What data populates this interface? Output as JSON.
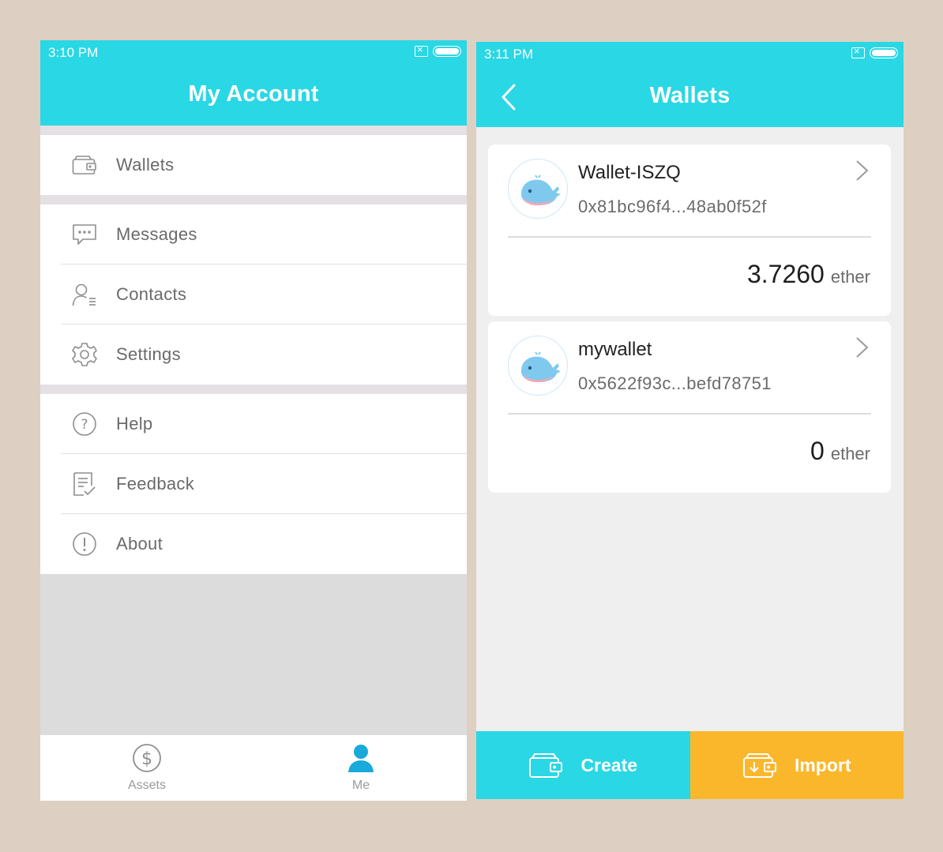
{
  "colors": {
    "accent": "#2ad7e4",
    "import": "#fbb72c",
    "active_tab": "#1aa9db",
    "inactive_tab": "#9a9a9a"
  },
  "left": {
    "status_time": "3:10 PM",
    "title": "My Account",
    "menu": {
      "wallets": {
        "label": "Wallets",
        "icon": "wallet-icon"
      },
      "messages": {
        "label": "Messages",
        "icon": "message-bubble-icon"
      },
      "contacts": {
        "label": "Contacts",
        "icon": "contacts-icon"
      },
      "settings": {
        "label": "Settings",
        "icon": "gear-icon"
      },
      "help": {
        "label": "Help",
        "icon": "question-circle-icon"
      },
      "feedback": {
        "label": "Feedback",
        "icon": "feedback-doc-icon"
      },
      "about": {
        "label": "About",
        "icon": "exclamation-circle-icon"
      }
    },
    "tabs": {
      "assets": {
        "label": "Assets",
        "icon": "dollar-circle-icon",
        "active": false
      },
      "me": {
        "label": "Me",
        "icon": "person-icon",
        "active": true
      }
    }
  },
  "right": {
    "status_time": "3:11 PM",
    "title": "Wallets",
    "wallets": [
      {
        "name": "Wallet-ISZQ",
        "address": "0x81bc96f4...48ab0f52f",
        "balance": "3.7260",
        "unit": "ether"
      },
      {
        "name": "mywallet",
        "address": "0x5622f93c...befd78751",
        "balance": "0",
        "unit": "ether"
      }
    ],
    "actions": {
      "create": {
        "label": "Create",
        "icon": "wallet-add-icon"
      },
      "import": {
        "label": "Import",
        "icon": "wallet-import-icon"
      }
    }
  }
}
